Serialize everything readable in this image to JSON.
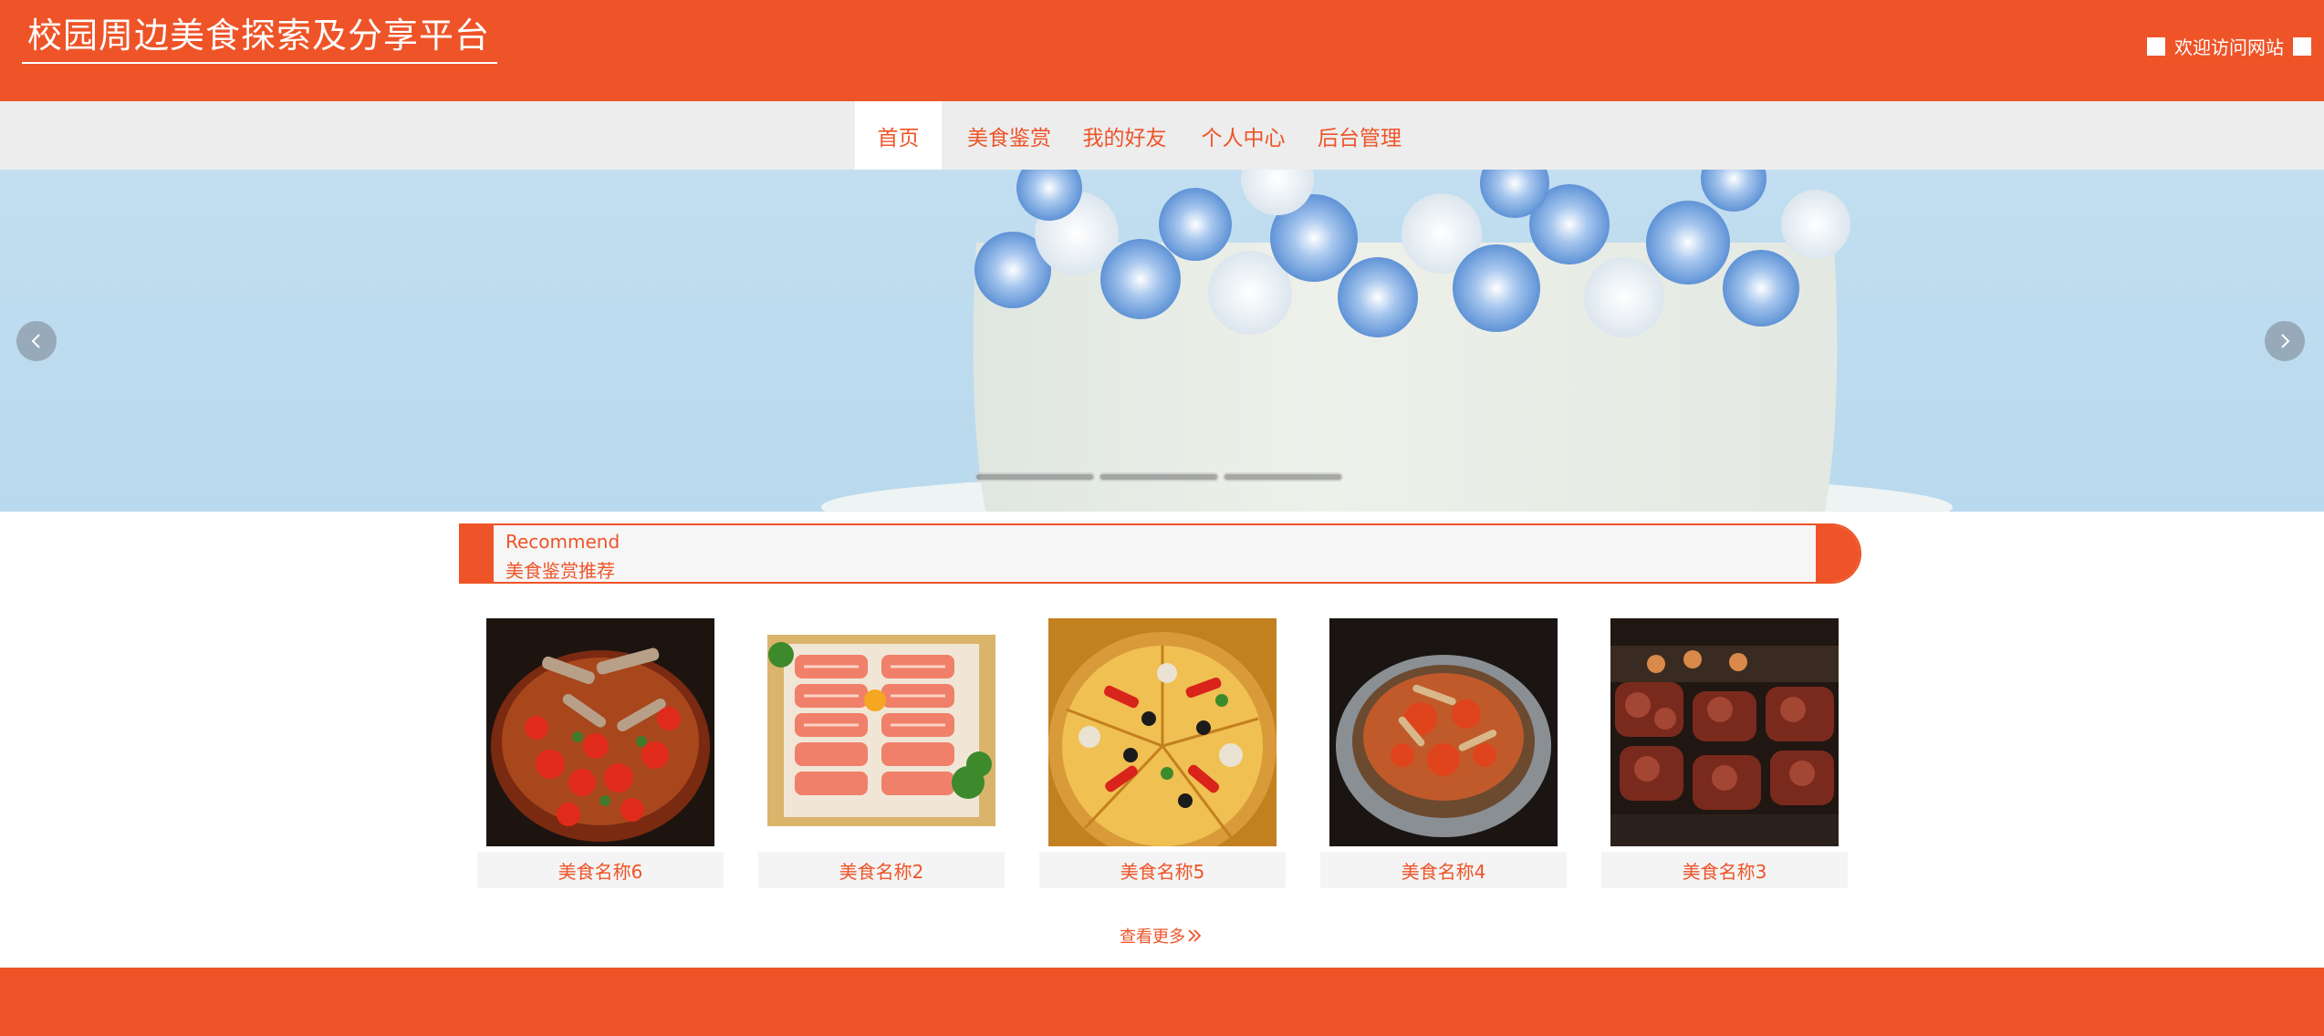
{
  "header": {
    "site_title": "校园周边美食探索及分享平台",
    "welcome_text": "欢迎访问网站"
  },
  "nav": {
    "items": [
      {
        "label": "首页",
        "active": true
      },
      {
        "label": "美食鉴赏",
        "active": false
      },
      {
        "label": "我的好友",
        "active": false
      },
      {
        "label": "个人中心",
        "active": false
      },
      {
        "label": "后台管理",
        "active": false
      }
    ]
  },
  "carousel": {
    "prev_icon": "chevron-left-icon",
    "next_icon": "chevron-right-icon",
    "slide_count": 3,
    "active_slide": 1
  },
  "recommend": {
    "title_en": "Recommend",
    "title_cn": "美食鉴赏推荐"
  },
  "foods": [
    {
      "name": "美食名称6"
    },
    {
      "name": "美食名称2"
    },
    {
      "name": "美食名称5"
    },
    {
      "name": "美食名称4"
    },
    {
      "name": "美食名称3"
    }
  ],
  "more_link": {
    "label": "查看更多",
    "icon": "double-chevron-right-icon"
  },
  "colors": {
    "accent": "#ee5428",
    "nav_bg": "#ededed",
    "card_label_bg": "#f4f4f4"
  }
}
